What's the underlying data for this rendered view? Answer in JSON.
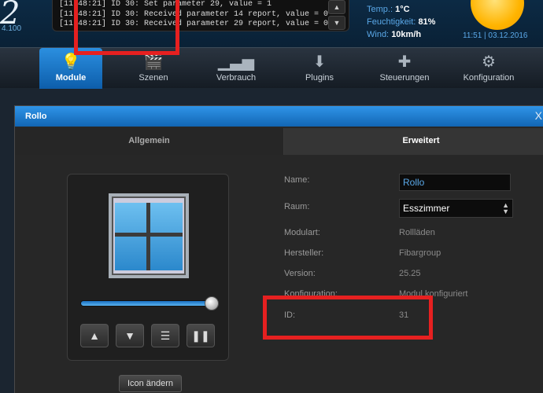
{
  "header": {
    "logo_number": "2",
    "version": "4.100",
    "log_lines": [
      "[11:48:21] ID 30: Set parameter 29, value = 1",
      "[11:48:21] ID 30: Received parameter 14 report, value = 0",
      "[11:48:21] ID 30: Received parameter 29 report, value = 0"
    ],
    "log_scroll_up": "▲",
    "log_scroll_down": "▼",
    "weather": {
      "temp_label": "Temp.:",
      "temp_value": "1°C",
      "humidity_label": "Feuchtigkeit:",
      "humidity_value": "81%",
      "wind_label": "Wind:",
      "wind_value": "10km/h"
    },
    "clock": "11:51 | 03.12.2016"
  },
  "nav": {
    "items": [
      {
        "label": "Module",
        "icon": "bulb-icon",
        "glyph": "💡"
      },
      {
        "label": "Szenen",
        "icon": "clapper-icon",
        "glyph": "🎬"
      },
      {
        "label": "Verbrauch",
        "icon": "chart-icon",
        "glyph": "▁▃▅"
      },
      {
        "label": "Plugins",
        "icon": "box-icon",
        "glyph": "⬇"
      },
      {
        "label": "Steuerungen",
        "icon": "puzzle-icon",
        "glyph": "✚"
      },
      {
        "label": "Konfiguration",
        "icon": "gear-icon",
        "glyph": "⚙"
      }
    ]
  },
  "dialog": {
    "title": "Rollo",
    "close": "X",
    "tabs": {
      "general": "Allgemein",
      "advanced": "Erweitert"
    },
    "controls": {
      "up": "▲",
      "down": "▼",
      "menu": "☰",
      "pause": "❚❚"
    },
    "icon_change_button": "Icon ändern",
    "slider_value": 1.0,
    "form": {
      "name_label": "Name:",
      "name_value": "Rollo",
      "room_label": "Raum:",
      "room_value": "Esszimmer",
      "type_label": "Modulart:",
      "type_value": "Rollläden",
      "manufacturer_label": "Hersteller:",
      "manufacturer_value": "Fibargroup",
      "version_label": "Version:",
      "version_value": "25.25",
      "config_label": "Konfiguration:",
      "config_value": "Modul konfiguriert",
      "id_label": "ID:",
      "id_value": "31"
    }
  },
  "colors": {
    "accent": "#1a7fd6",
    "highlight": "#e62020"
  }
}
